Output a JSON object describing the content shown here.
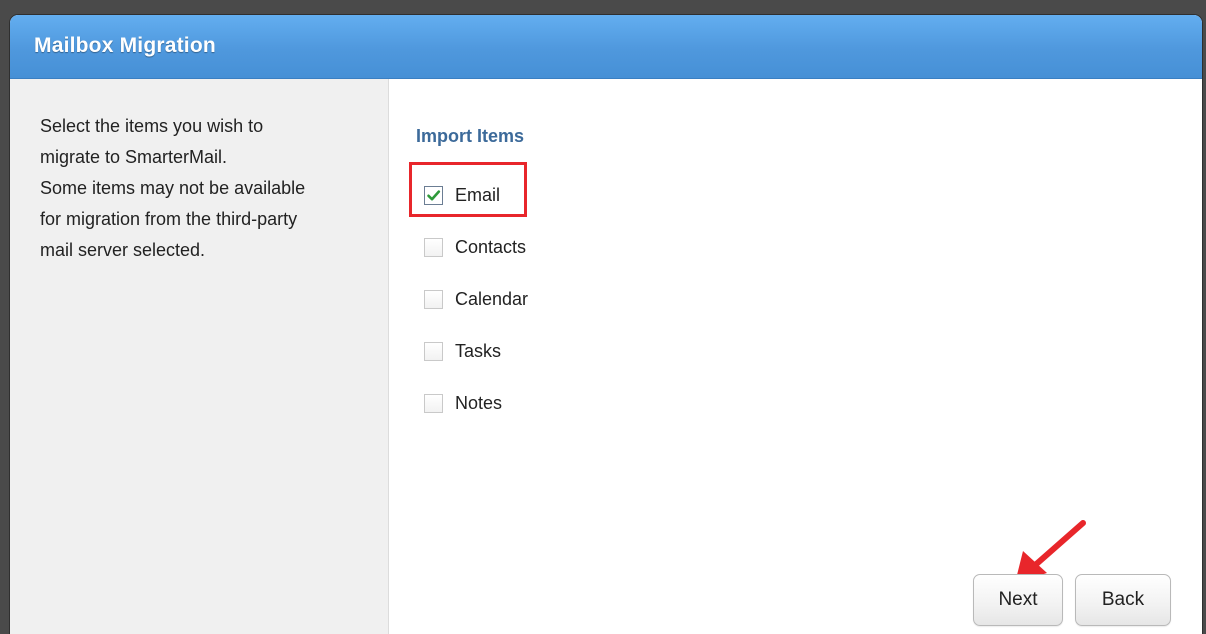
{
  "dialog": {
    "title": "Mailbox Migration"
  },
  "sidebar": {
    "line1": "Select the items you wish to",
    "line2": "migrate to SmarterMail.",
    "line3": "Some items may not be available",
    "line4": "for migration from the third-party",
    "line5": "mail server selected."
  },
  "import": {
    "heading": "Import Items",
    "items": [
      {
        "label": "Email",
        "checked": true
      },
      {
        "label": "Contacts",
        "checked": false
      },
      {
        "label": "Calendar",
        "checked": false
      },
      {
        "label": "Tasks",
        "checked": false
      },
      {
        "label": "Notes",
        "checked": false
      }
    ]
  },
  "buttons": {
    "next": "Next",
    "back": "Back"
  },
  "colors": {
    "titlebar": "#4f98dd",
    "heading": "#3c6a9a",
    "highlight": "#e8262b",
    "check": "#2e9a3a"
  }
}
